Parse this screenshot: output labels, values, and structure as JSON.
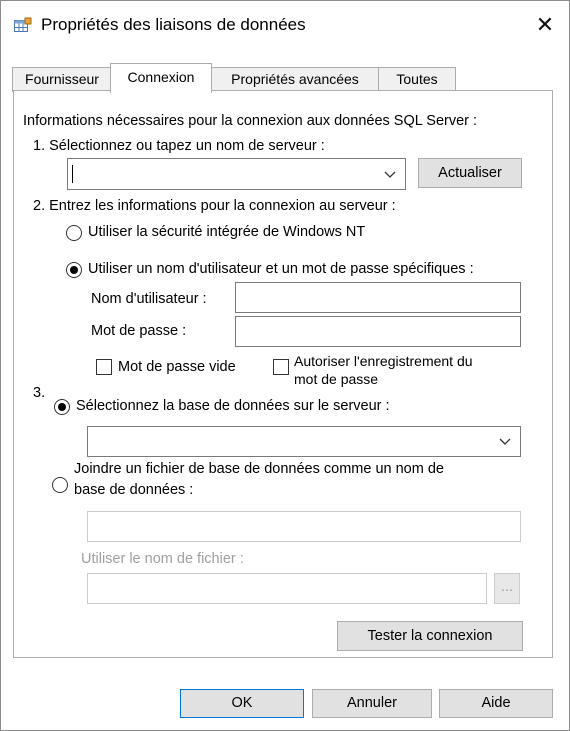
{
  "window": {
    "title": "Propriétés des liaisons de données",
    "close_glyph": "✕"
  },
  "tabs": [
    {
      "label": "Fournisseur",
      "active": false
    },
    {
      "label": "Connexion",
      "active": true
    },
    {
      "label": "Propriétés avancées",
      "active": false
    },
    {
      "label": "Toutes",
      "active": false
    }
  ],
  "connection": {
    "intro": "Informations nécessaires pour la connexion aux données SQL Server :",
    "step1_label": "1. Sélectionnez ou tapez un nom de serveur :",
    "server_value": "",
    "refresh_label": "Actualiser",
    "step2_label": "2. Entrez les informations pour la connexion au serveur :",
    "auth_windows_label": "Utiliser la sécurité intégrée de Windows NT",
    "auth_sql_label": "Utiliser un nom d'utilisateur et un mot de passe spécifiques :",
    "auth_selected": "sql",
    "username_label": "Nom d'utilisateur :",
    "username_value": "",
    "password_label": "Mot de passe :",
    "password_value": "",
    "blank_password_label": "Mot de passe vide",
    "allow_save_label_1": "Autoriser l'enregistrement du",
    "allow_save_label_2": "mot de passe",
    "step3_number": "3.",
    "select_db_label": "Sélectionnez la base de données sur le serveur :",
    "database_value": "",
    "attach_label_1": "Joindre un fichier de base de données comme un nom de",
    "attach_label_2": "base de données :",
    "attach_name_value": "",
    "use_filename_label": "Utiliser le nom de fichier :",
    "filename_value": "",
    "browse_label": "...",
    "test_label": "Tester la connexion",
    "db_mode_selected": "select"
  },
  "footer": {
    "ok_label": "OK",
    "cancel_label": "Annuler",
    "help_label": "Aide"
  },
  "icons": {
    "app": "data-link-icon",
    "dropdown": "chevron-down-icon"
  }
}
